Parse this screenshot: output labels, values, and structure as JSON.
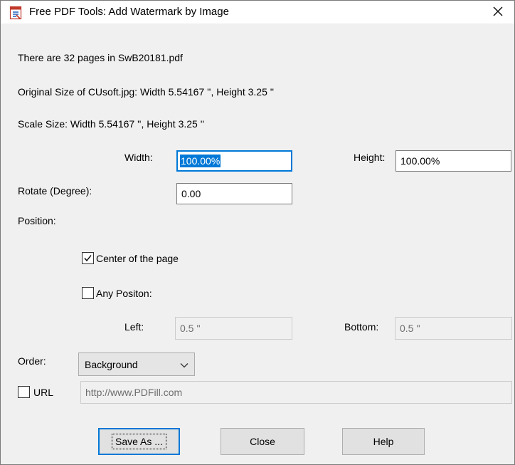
{
  "window": {
    "title": "Free PDF Tools: Add Watermark by Image",
    "icons": {
      "app": "pdf-app-icon",
      "close": "close-icon"
    }
  },
  "info": {
    "pages_text": "There are 32 pages in SwB20181.pdf",
    "original_size_text": "Original Size of CUsoft.jpg:  Width 5.54167 '',   Height 3.25 ''",
    "scale_size_text": "Scale Size:  Width 5.54167 '',   Height 3.25 ''"
  },
  "size": {
    "width_label": "Width:",
    "width_value": "100.00%",
    "height_label": "Height:",
    "height_value": "100.00%"
  },
  "rotate": {
    "label": "Rotate (Degree):",
    "value": "0.00"
  },
  "position": {
    "label": "Position:",
    "center": {
      "label": "Center of the page",
      "checked": true
    },
    "any": {
      "label": "Any Positon:",
      "checked": false
    },
    "left_label": "Left:",
    "left_value": "0.5 ''",
    "bottom_label": "Bottom:",
    "bottom_value": "0.5 ''"
  },
  "order": {
    "label": "Order:",
    "selected": "Background",
    "icon": "chevron-down-icon"
  },
  "url": {
    "label": "URL",
    "checked": false,
    "value": "http://www.PDFill.com"
  },
  "buttons": {
    "save_as": "Save As ...",
    "close": "Close",
    "help": "Help"
  },
  "colors": {
    "accent": "#0078d7",
    "dialog_bg": "#f0f0f0",
    "disabled_text": "#6d6d6d"
  }
}
